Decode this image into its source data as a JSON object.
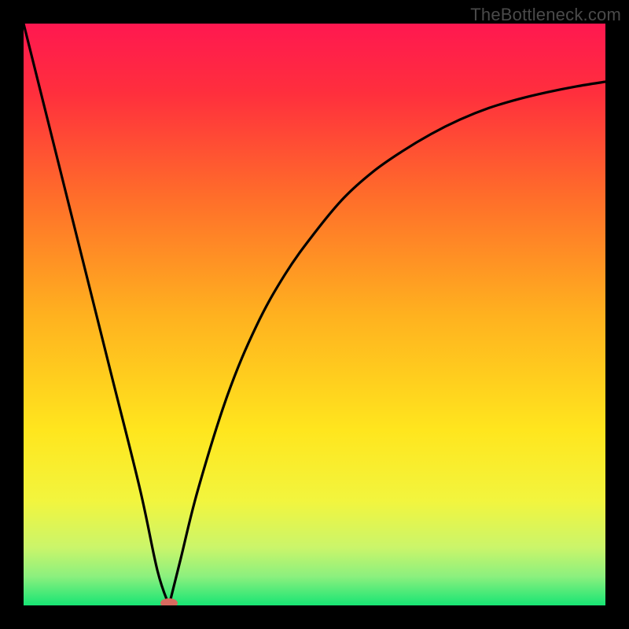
{
  "watermark": "TheBottleneck.com",
  "chart_data": {
    "type": "line",
    "title": "",
    "xlabel": "",
    "ylabel": "",
    "xlim": [
      0,
      100
    ],
    "ylim": [
      0,
      100
    ],
    "grid": false,
    "legend": false,
    "background_gradient": {
      "stops": [
        {
          "offset": 0.0,
          "color": "#ff1850"
        },
        {
          "offset": 0.12,
          "color": "#ff2f3d"
        },
        {
          "offset": 0.3,
          "color": "#ff6e2a"
        },
        {
          "offset": 0.5,
          "color": "#ffb11f"
        },
        {
          "offset": 0.7,
          "color": "#ffe61e"
        },
        {
          "offset": 0.82,
          "color": "#f2f53e"
        },
        {
          "offset": 0.9,
          "color": "#cbf56a"
        },
        {
          "offset": 0.95,
          "color": "#8cf07e"
        },
        {
          "offset": 1.0,
          "color": "#17e574"
        }
      ]
    },
    "series": [
      {
        "name": "left-branch",
        "x": [
          0,
          5,
          10,
          15,
          20,
          23,
          25
        ],
        "values": [
          100,
          80,
          60,
          40,
          20,
          6,
          0
        ]
      },
      {
        "name": "right-branch",
        "x": [
          25,
          27,
          30,
          35,
          40,
          45,
          50,
          55,
          60,
          65,
          70,
          75,
          80,
          85,
          90,
          95,
          100
        ],
        "values": [
          0,
          8,
          20,
          36,
          48,
          57,
          64,
          70,
          74.5,
          78,
          81,
          83.5,
          85.5,
          87,
          88.2,
          89.2,
          90
        ]
      }
    ],
    "marker": {
      "x": 25,
      "y": 0,
      "color": "#d86a5f",
      "rx": 11,
      "ry": 6
    }
  }
}
